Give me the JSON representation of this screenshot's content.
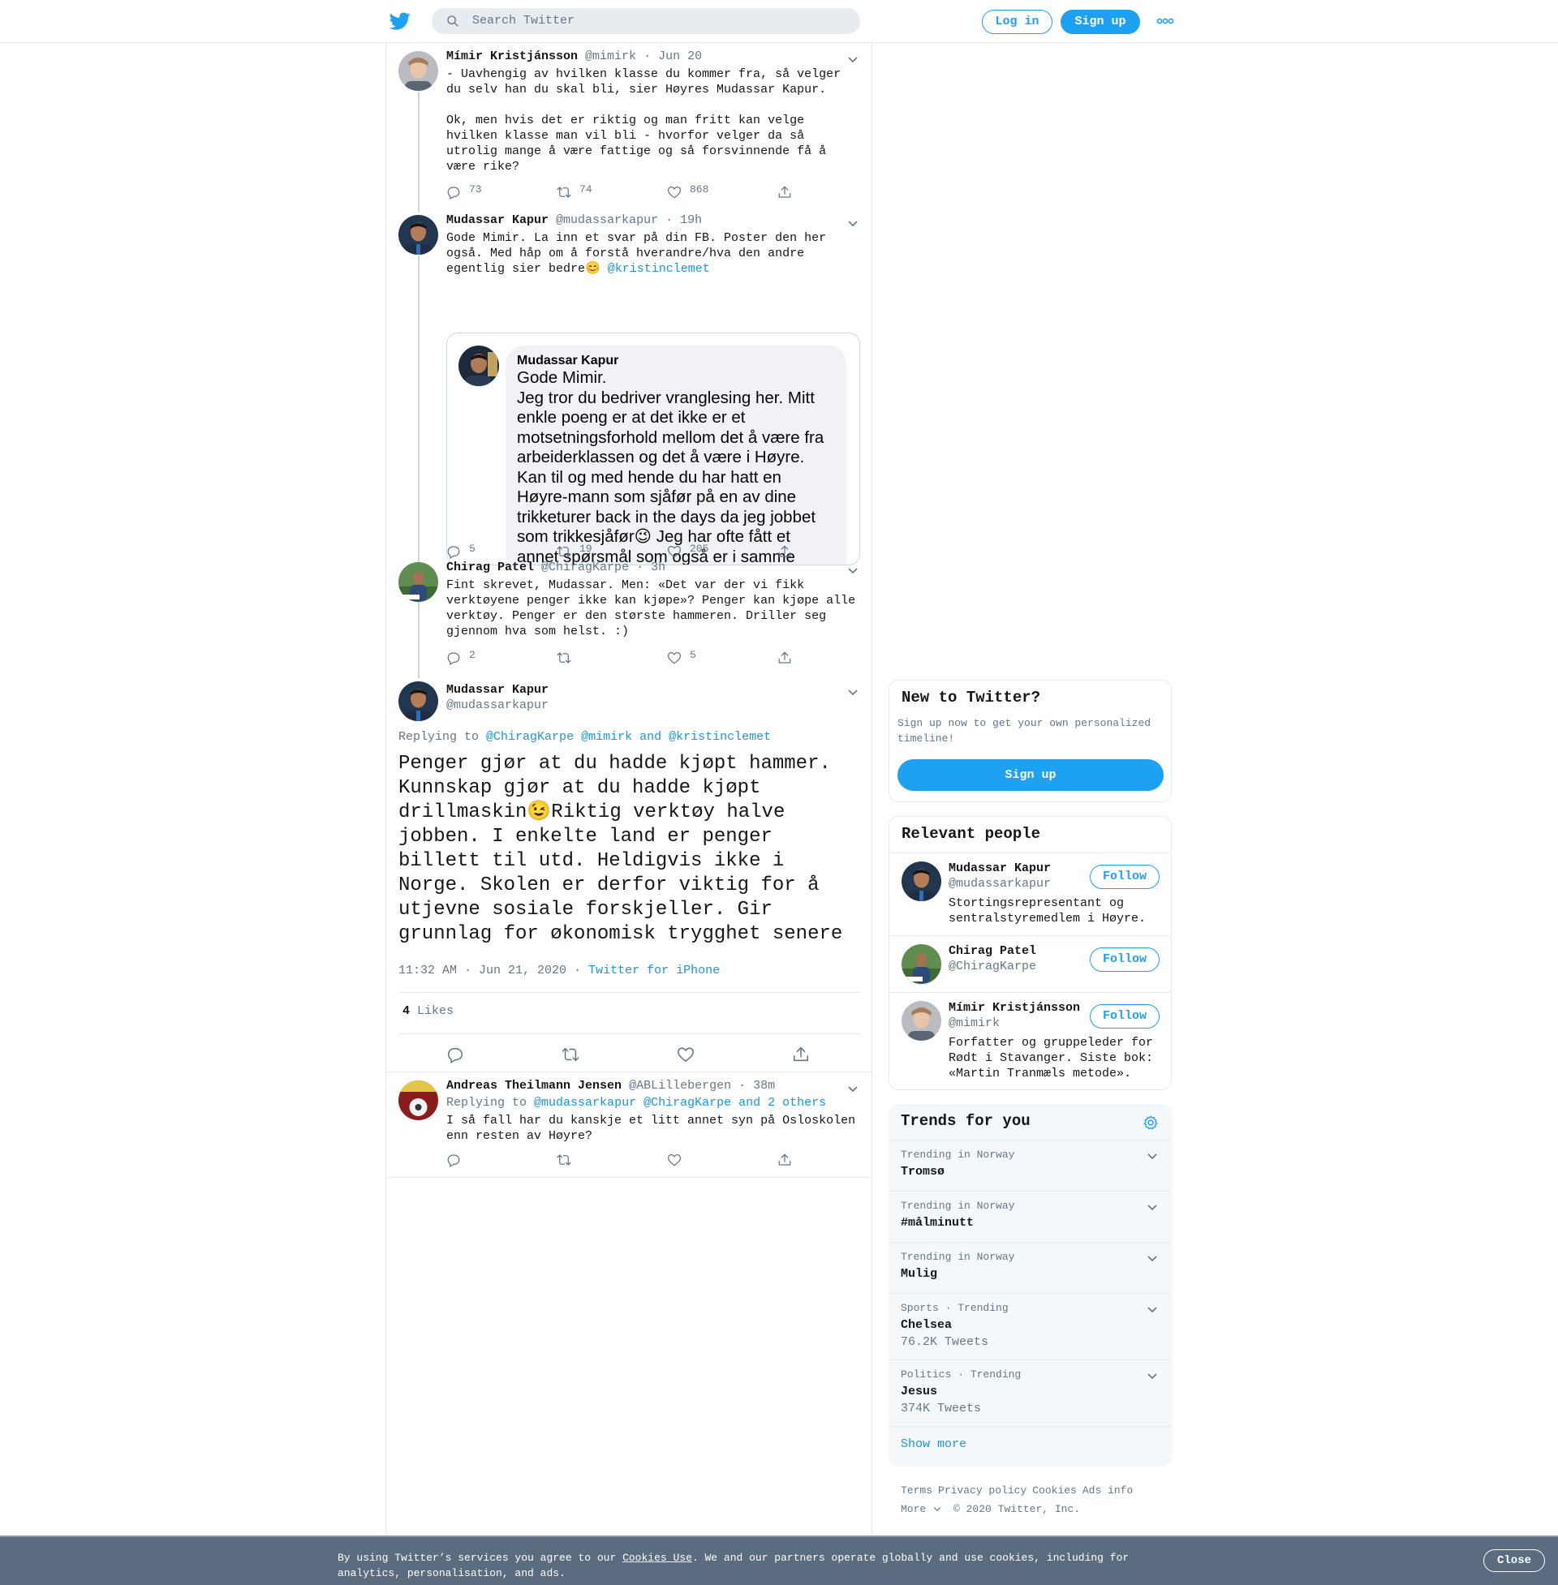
{
  "header": {
    "search_placeholder": "Search Twitter",
    "login_label": "Log in",
    "signup_label": "Sign up"
  },
  "thread": [
    {
      "name": "Mímir Kristjánsson",
      "handle": "@mimirk",
      "time": "Jun 20",
      "text": "- Uavhengig av hvilken klasse du kommer fra, så velger du selv han du skal bli, sier Høyres Mudassar Kapur.\n\nOk, men hvis det er riktig og man fritt kan velge hvilken klasse man vil bli - hvorfor velger da så utrolig mange å være fattige og så forsvinnende få å være rike?",
      "replies": "73",
      "retweets": "74",
      "likes": "868"
    },
    {
      "name": "Mudassar Kapur",
      "handle": "@mudassarkapur",
      "time": "19h",
      "text": "Gode Mimir. La inn et svar på din FB. Poster den her også. Med håp om å forstå hverandre/hva den andre egentlig sier bedre😊 ",
      "mention": "@kristinclemet",
      "embed_name": "Mudassar Kapur",
      "embed_text": "Gode Mimir.\nJeg tror du bedriver vranglesing her. Mitt enkle poeng er at det ikke er et motsetningsforhold mellom det å være fra arbeiderklassen og det å være i Høyre. Kan til og med hende du har hatt en Høyre-mann som sjåfør på en av dine trikketurer back in the days da jeg jobbet som trikkesjåfør😉 Jeg har ofte fått et annet spørsmål som også er i samme gate: «Du",
      "replies": "5",
      "retweets": "19",
      "likes": "205"
    },
    {
      "name": "Chirag Patel",
      "handle": "@ChiragKarpe",
      "time": "3h",
      "text": "Fint skrevet, Mudassar. Men: «Det var der vi fikk verktøyene penger ikke kan kjøpe»? Penger kan kjøpe alle verktøy. Penger er den største hammeren. Driller seg gjennom hva som helst. :)",
      "replies": "2",
      "retweets": "",
      "likes": "5"
    }
  ],
  "main_tweet": {
    "name": "Mudassar Kapur",
    "handle": "@mudassarkapur",
    "replying_label": "Replying to",
    "replying_to": "@ChiragKarpe @mimirk and @kristinclemet",
    "text": "Penger gjør at du hadde kjøpt hammer. Kunnskap gjør at du hadde kjøpt drillmaskin😉Riktig verktøy halve jobben. I enkelte land er penger billett til utd. Heldigvis ikke i Norge. Skolen er derfor viktig for å utjevne sosiale forskjeller. Gir grunnlag for økonomisk trygghet senere",
    "timestamp": "11:32 AM · Jun 21, 2020",
    "source": "Twitter for iPhone",
    "likes_count": "4",
    "likes_label": "Likes"
  },
  "reply": {
    "name": "Andreas Theilmann Jensen",
    "handle": "@ABLillebergen",
    "time": "38m",
    "replying_label": "Replying to",
    "replying_to": "@mudassarkapur @ChiragKarpe and 2 others",
    "text": "I så fall har du kanskje et litt annet syn på Osloskolen enn resten av Høyre?"
  },
  "sidebar": {
    "new_title": "New to Twitter?",
    "new_desc": "Sign up now to get your own personalized timeline!",
    "new_signup": "Sign up",
    "people_title": "Relevant people",
    "follow_label": "Follow",
    "people": [
      {
        "name": "Mudassar Kapur",
        "handle": "@mudassarkapur",
        "bio": "Stortingsrepresentant og sentralstyremedlem i Høyre."
      },
      {
        "name": "Chirag Patel",
        "handle": "@ChiragKarpe",
        "bio": ""
      },
      {
        "name": "Mímir Kristjánsson",
        "handle": "@mimirk",
        "bio": "Forfatter og gruppeleder for Rødt i Stavanger. Siste bok: «Martin Tranmæls metode»."
      }
    ],
    "trends_title": "Trends for you",
    "trends": [
      {
        "context": "Trending in Norway",
        "name": "Tromsø",
        "count": ""
      },
      {
        "context": "Trending in Norway",
        "name": "#målminutt",
        "count": ""
      },
      {
        "context": "Trending in Norway",
        "name": "Mulig",
        "count": ""
      },
      {
        "context": "Sports · Trending",
        "name": "Chelsea",
        "count": "76.2K Tweets"
      },
      {
        "context": "Politics · Trending",
        "name": "Jesus",
        "count": "374K Tweets"
      }
    ],
    "show_more": "Show more",
    "footer": [
      "Terms",
      "Privacy policy",
      "Cookies",
      "Ads info"
    ],
    "footer_more": "More",
    "copyright": "© 2020 Twitter, Inc."
  },
  "cookie": {
    "text_before": "By using Twitter’s services you agree to our ",
    "link": "Cookies Use",
    "text_after": ". We and our partners operate globally and use cookies, including for analytics, personalisation, and ads.",
    "close_label": "Close"
  },
  "colors": {
    "brand": "#1da1f2",
    "link": "#1b95e0",
    "muted": "#657786",
    "cookie_bg": "#5b6c80"
  }
}
